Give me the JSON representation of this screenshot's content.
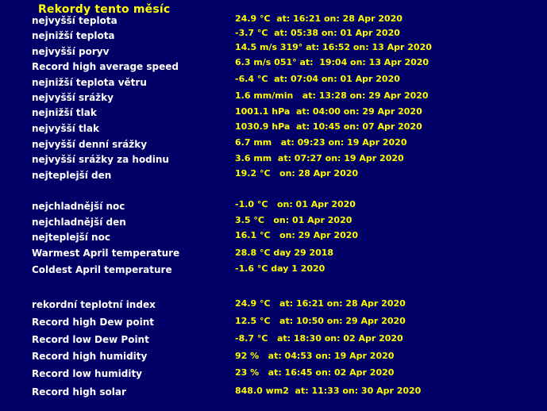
{
  "title": "Rekordy tento měsíc",
  "colors": {
    "background": "#000066",
    "label": "#ffffff",
    "value": "#ffff00"
  },
  "records": [
    {
      "label": "nejvyšší teplota",
      "value": "24.9 °C  at: 16:21 on: 28 Apr 2020"
    },
    {
      "label": "nejnižší teplota",
      "value": "-3.7 °C  at: 05:38 on: 01 Apr 2020"
    },
    {
      "label": "nejvyšší poryv",
      "value": "14.5 m/s 319° at: 16:52 on: 13 Apr 2020"
    },
    {
      "label": "Record high average speed",
      "value": "6.3 m/s 051° at:  19:04 on: 13 Apr 2020"
    },
    {
      "label": "nejnižší teplota větru",
      "value": "-6.4 °C  at: 07:04 on: 01 Apr 2020"
    },
    {
      "label": "nejvyšší srážky",
      "value": "1.6 mm/min   at: 13:28 on: 29 Apr 2020"
    },
    {
      "label": "nejnižší tlak",
      "value": "1001.1 hPa  at: 04:00 on: 29 Apr 2020"
    },
    {
      "label": "nejvyšší tlak",
      "value": "1030.9 hPa  at: 10:45 on: 07 Apr 2020"
    },
    {
      "label": "nejvyšší denní srážky",
      "value": "6.7 mm   at: 09:23 on: 19 Apr 2020"
    },
    {
      "label": "nejvyšší srážky za hodinu",
      "value": "3.6 mm  at: 07:27 on: 19 Apr 2020"
    },
    {
      "label": "nejteplejší den",
      "value": "19.2 °C   on: 28 Apr 2020"
    },
    {
      "label": "nejchladnější noc",
      "value": "-1.0 °C   on: 01 Apr 2020"
    },
    {
      "label": "nejchladnější den",
      "value": "3.5 °C   on: 01 Apr 2020"
    },
    {
      "label": "nejteplejší noc",
      "value": "16.1 °C   on: 29 Apr 2020"
    },
    {
      "label": "Warmest April temperature",
      "value": "28.8 °C day 29 2018"
    },
    {
      "label": "Coldest April temperature",
      "value": "-1.6 °C day 1 2020"
    },
    {
      "label": "rekordní teplotní index",
      "value": "24.9 °C   at: 16:21 on: 28 Apr 2020"
    },
    {
      "label": "Record high Dew point",
      "value": "12.5 °C   at: 10:50 on: 29 Apr 2020"
    },
    {
      "label": "Record low Dew Point",
      "value": "-8.7 °C   at: 18:30 on: 02 Apr 2020"
    },
    {
      "label": "Record high humidity",
      "value": "92 %   at: 04:53 on: 19 Apr 2020"
    },
    {
      "label": "Record low humidity",
      "value": "23 %   at: 16:45 on: 02 Apr 2020"
    },
    {
      "label": "Record high solar",
      "value": "848.0 wm2  at: 11:33 on: 30 Apr 2020"
    }
  ]
}
